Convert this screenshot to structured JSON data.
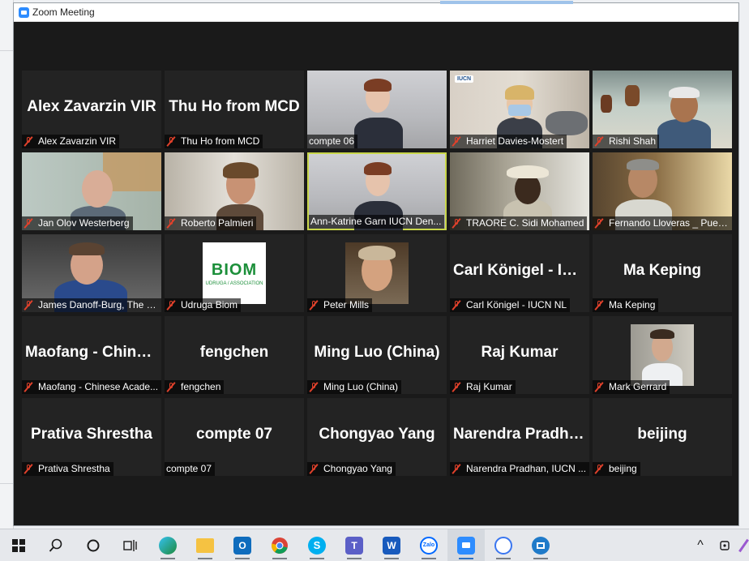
{
  "window": {
    "title": "Zoom Meeting"
  },
  "participants": [
    {
      "big_name": "Alex Zavarzin VIR",
      "label": "Alex Zavarzin VIR",
      "muted": true
    },
    {
      "big_name": "Thu Ho from MCD",
      "label": "Thu Ho from MCD",
      "muted": true
    },
    {
      "big_name": "",
      "label": "compte 06",
      "muted": false
    },
    {
      "big_name": "",
      "label": "Harriet Davies-Mostert",
      "muted": true,
      "badge": "IUCN"
    },
    {
      "big_name": "",
      "label": "Rishi Shah",
      "muted": true
    },
    {
      "big_name": "",
      "label": "Jan Olov Westerberg",
      "muted": true
    },
    {
      "big_name": "",
      "label": "Roberto Palmieri",
      "muted": true
    },
    {
      "big_name": "",
      "label": "Ann-Katrine Garn IUCN Den...",
      "muted": false,
      "active": true
    },
    {
      "big_name": "",
      "label": "TRAORE C. Sidi Mohamed",
      "muted": true
    },
    {
      "big_name": "",
      "label": "Fernando Lloveras _ Puert...",
      "muted": true
    },
    {
      "big_name": "",
      "label": "James Danoff-Burg, The L...",
      "muted": true
    },
    {
      "big_name": "",
      "label": "Udruga Biom",
      "muted": true,
      "logo_title": "BIOM",
      "logo_sub": "UDRUGA / ASSOCIATION"
    },
    {
      "big_name": "",
      "label": "Peter Mills",
      "muted": true
    },
    {
      "big_name": "Carl Königel - IUCN NL",
      "label": "Carl Königel - IUCN NL",
      "muted": true
    },
    {
      "big_name": "Ma Keping",
      "label": "Ma Keping",
      "muted": true
    },
    {
      "big_name": "Maofang - Chinese Academy",
      "label": "Maofang - Chinese Acade...",
      "muted": true
    },
    {
      "big_name": "fengchen",
      "label": "fengchen",
      "muted": true
    },
    {
      "big_name": "Ming Luo  (China)",
      "label": "Ming Luo  (China)",
      "muted": true
    },
    {
      "big_name": "Raj Kumar",
      "label": "Raj Kumar",
      "muted": true
    },
    {
      "big_name": "",
      "label": "Mark Gerrard",
      "muted": true
    },
    {
      "big_name": "Prativa Shrestha",
      "label": "Prativa Shrestha",
      "muted": true
    },
    {
      "big_name": "compte 07",
      "label": "compte 07",
      "muted": false
    },
    {
      "big_name": "Chongyao Yang",
      "label": "Chongyao Yang",
      "muted": true
    },
    {
      "big_name": "Narendra  Pradhan",
      "label": "Narendra Pradhan, IUCN ...",
      "muted": true
    },
    {
      "big_name": "beijing",
      "label": "beijing",
      "muted": true
    }
  ],
  "taskbar": {
    "apps": [
      {
        "name": "start-icon"
      },
      {
        "name": "search-icon"
      },
      {
        "name": "cortana-icon"
      },
      {
        "name": "task-view-icon"
      },
      {
        "name": "edge-icon"
      },
      {
        "name": "file-explorer-icon"
      },
      {
        "name": "outlook-icon",
        "letter": "O"
      },
      {
        "name": "chrome-icon"
      },
      {
        "name": "skype-icon",
        "letter": "S"
      },
      {
        "name": "teams-icon",
        "letter": "T"
      },
      {
        "name": "word-icon",
        "letter": "W"
      },
      {
        "name": "zalo-icon",
        "letter": "Zalo"
      },
      {
        "name": "zoom-icon"
      },
      {
        "name": "signal-icon"
      },
      {
        "name": "remote-desktop-icon"
      }
    ],
    "tray": {
      "chevron": "^"
    }
  },
  "colors": {
    "active_speaker": "#c8d64a",
    "muted_icon": "#e0412b",
    "zoom_blue": "#2d8cff"
  }
}
